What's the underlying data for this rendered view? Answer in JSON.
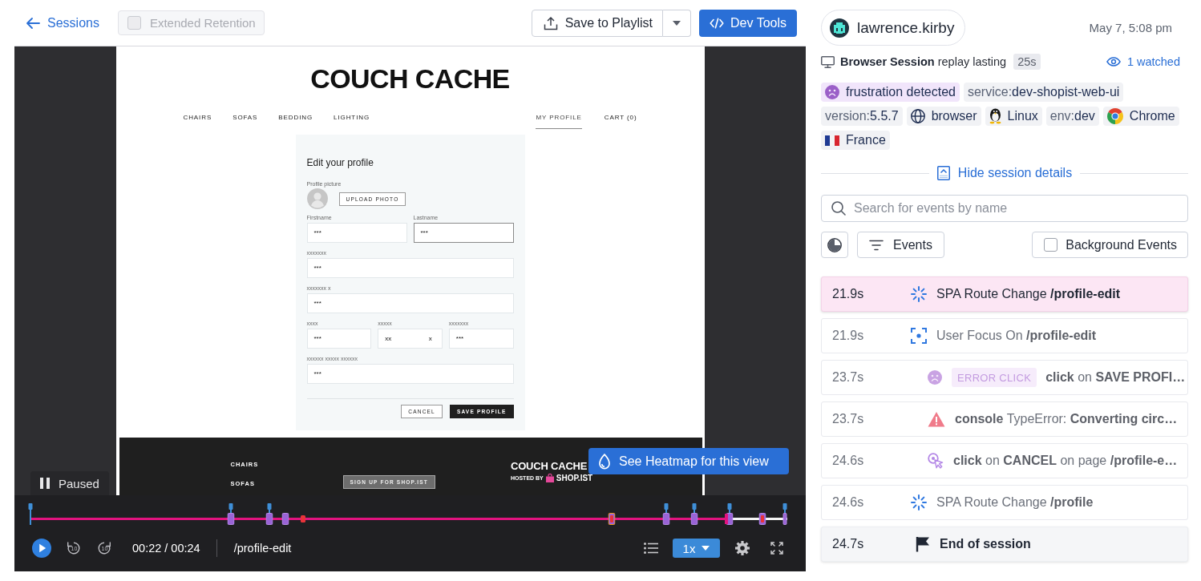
{
  "header": {
    "back_link": "Sessions",
    "retention": {
      "label": "Extended Retention",
      "checked": false,
      "disabled": true
    },
    "playlist_button": "Save to Playlist",
    "devtools_button": "Dev Tools"
  },
  "player": {
    "page": {
      "logo": "COUCH CACHE",
      "nav": {
        "left": [
          {
            "label": "CHAIRS",
            "selected": false
          },
          {
            "label": "SOFAS",
            "selected": false
          },
          {
            "label": "BEDDING",
            "selected": false
          },
          {
            "label": "LIGHTING",
            "selected": false
          }
        ],
        "right": [
          {
            "label": "MY PROFILE",
            "selected": true
          },
          {
            "label": "CART (0)",
            "selected": false
          }
        ]
      },
      "form": {
        "title": "Edit your profile",
        "picture_label": "Profile picture",
        "upload_button": "UPLOAD PHOTO",
        "rows": [
          {
            "fields": [
              {
                "label": "Firstname",
                "value": "***",
                "focused": false
              },
              {
                "label": "Lastname",
                "value": "***",
                "focused": true
              }
            ]
          },
          {
            "fields": [
              {
                "label": "xxxxxxx",
                "value": "***",
                "focused": false
              }
            ]
          },
          {
            "fields": [
              {
                "label": "xxxxxxx x",
                "value": "***",
                "focused": false
              }
            ]
          },
          {
            "fields": [
              {
                "label": "xxxx",
                "value": "***",
                "focused": false
              },
              {
                "label": "xxxxx",
                "value": "xx",
                "suffix": "x",
                "focused": false
              },
              {
                "label": "xxxxxxx",
                "value": "***",
                "focused": false
              }
            ]
          },
          {
            "fields": [
              {
                "label": "xxxxxx xxxxx xxxxxx",
                "value": "***",
                "focused": false
              }
            ]
          }
        ],
        "cancel_button": "CANCEL",
        "save_button": "SAVE PROFILE"
      },
      "footer": {
        "links": [
          "CHAIRS",
          "SOFAS"
        ],
        "signup_button": "SIGN UP FOR SHOP.IST",
        "logo": "COUCH CACHE",
        "hosted_by": "HOSTED BY",
        "host": "SHOP.IST"
      }
    },
    "heatmap_button": "See Heatmap for this view",
    "status": "Paused",
    "progress": {
      "level": 0.92
    },
    "skip_back": "10",
    "skip_forward": "10",
    "time": "00:22 / 00:24",
    "path": "/profile-edit",
    "speed": "1x"
  },
  "session": {
    "user": "lawrence.kirby",
    "date": "May 7, 5:08 pm",
    "summary": "**Browser Session** replay lasting",
    "duration": "25s",
    "watched": "1 watched",
    "tags": [
      {
        "kind": "frustration",
        "text": "frustration detected"
      },
      {
        "kind": "field",
        "key": "service:",
        "value": "dev-shopist-web-ui"
      },
      {
        "kind": "field",
        "key": "version:",
        "value": "5.5.7"
      },
      {
        "kind": "device",
        "text": "browser"
      },
      {
        "kind": "os",
        "text": "Linux"
      },
      {
        "kind": "field",
        "key": "env:",
        "value": "dev"
      },
      {
        "kind": "browser",
        "text": "Chrome"
      },
      {
        "kind": "country",
        "text": "France"
      }
    ],
    "details_toggle": "Hide session details"
  },
  "events": {
    "search": {
      "placeholder": "Search for events by name"
    },
    "filter_button": "Events",
    "background": {
      "label": "Background Events",
      "checked": false
    },
    "items": [
      {
        "time": "21.9s",
        "kind": "route",
        "text": "SPA Route Change **/profile-edit**",
        "selected": true
      },
      {
        "time": "21.9s",
        "kind": "focus",
        "text": "User Focus On **/profile-edit**",
        "selected": false
      },
      {
        "time": "23.7s",
        "kind": "error_click",
        "badge": "ERROR CLICK",
        "text": "**click** on **SAVE PROFI…**",
        "selected": false
      },
      {
        "time": "23.7s",
        "kind": "console",
        "text": "**console** TypeError: **Converting circ…**",
        "selected": false
      },
      {
        "time": "24.6s",
        "kind": "click",
        "text": "**click** on **CANCEL** on page **/profile-e…**",
        "selected": false
      },
      {
        "time": "24.6s",
        "kind": "route",
        "text": "SPA Route Change **/profile**",
        "selected": false
      },
      {
        "time": "24.7s",
        "kind": "end",
        "text": "**End of session**",
        "selected": false
      }
    ]
  }
}
